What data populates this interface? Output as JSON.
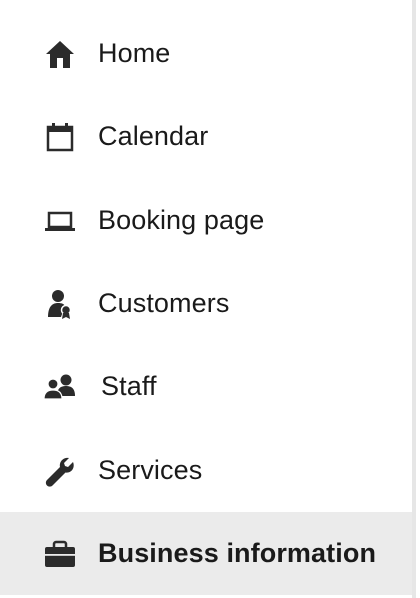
{
  "nav": {
    "selected_index": 6,
    "items": [
      {
        "label": "Home",
        "icon": "home-icon"
      },
      {
        "label": "Calendar",
        "icon": "calendar-icon"
      },
      {
        "label": "Booking page",
        "icon": "laptop-icon"
      },
      {
        "label": "Customers",
        "icon": "customer-icon"
      },
      {
        "label": "Staff",
        "icon": "people-icon"
      },
      {
        "label": "Services",
        "icon": "wrench-icon"
      },
      {
        "label": "Business information",
        "icon": "briefcase-icon"
      }
    ]
  },
  "colors": {
    "text": "#1a1a1a",
    "icon": "#2b2b2b",
    "selected_background": "#ebebeb",
    "background": "#ffffff"
  }
}
